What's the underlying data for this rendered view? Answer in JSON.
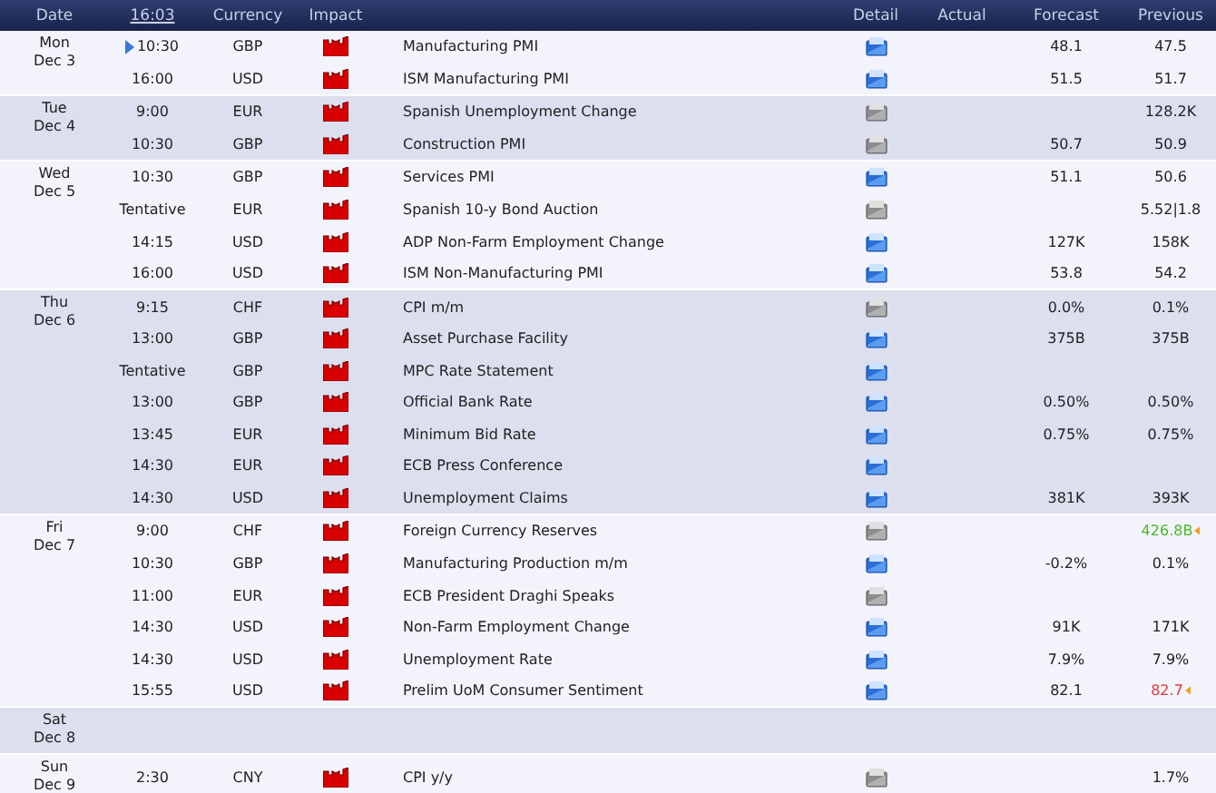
{
  "header": {
    "date": "Date",
    "clock": "16:03",
    "currency": "Currency",
    "impact": "Impact",
    "detail": "Detail",
    "actual": "Actual",
    "forecast": "Forecast",
    "previous": "Previous"
  },
  "days": [
    {
      "weekday": "Mon",
      "date": "Dec 3",
      "events": [
        {
          "time": "10:30",
          "next": true,
          "currency": "GBP",
          "high_impact": true,
          "event": "Manufacturing PMI",
          "detail": true,
          "forecast": "48.1",
          "previous": "47.5"
        },
        {
          "time": "16:00",
          "next": false,
          "currency": "USD",
          "high_impact": true,
          "event": "ISM Manufacturing PMI",
          "detail": true,
          "forecast": "51.5",
          "previous": "51.7"
        }
      ]
    },
    {
      "weekday": "Tue",
      "date": "Dec 4",
      "events": [
        {
          "time": "9:00",
          "next": false,
          "currency": "EUR",
          "high_impact": true,
          "event": "Spanish Unemployment Change",
          "detail": false,
          "previous": "128.2K"
        },
        {
          "time": "10:30",
          "next": false,
          "currency": "GBP",
          "high_impact": true,
          "event": "Construction PMI",
          "detail": false,
          "forecast": "50.7",
          "previous": "50.9"
        }
      ]
    },
    {
      "weekday": "Wed",
      "date": "Dec 5",
      "events": [
        {
          "time": "10:30",
          "next": false,
          "currency": "GBP",
          "high_impact": true,
          "event": "Services PMI",
          "detail": true,
          "forecast": "51.1",
          "previous": "50.6"
        },
        {
          "time": "Tentative",
          "next": false,
          "currency": "EUR",
          "high_impact": true,
          "event": "Spanish 10-y Bond Auction",
          "detail": false,
          "previous": "5.52|1.8"
        },
        {
          "time": "14:15",
          "next": false,
          "currency": "USD",
          "high_impact": true,
          "event": "ADP Non-Farm Employment Change",
          "detail": true,
          "forecast": "127K",
          "previous": "158K"
        },
        {
          "time": "16:00",
          "next": false,
          "currency": "USD",
          "high_impact": true,
          "event": "ISM Non-Manufacturing PMI",
          "detail": true,
          "forecast": "53.8",
          "previous": "54.2"
        }
      ]
    },
    {
      "weekday": "Thu",
      "date": "Dec 6",
      "events": [
        {
          "time": "9:15",
          "next": false,
          "currency": "CHF",
          "high_impact": true,
          "event": "CPI m/m",
          "detail": false,
          "forecast": "0.0%",
          "previous": "0.1%"
        },
        {
          "time": "13:00",
          "next": false,
          "currency": "GBP",
          "high_impact": true,
          "event": "Asset Purchase Facility",
          "detail": true,
          "forecast": "375B",
          "previous": "375B"
        },
        {
          "time": "Tentative",
          "next": false,
          "currency": "GBP",
          "high_impact": true,
          "event": "MPC Rate Statement",
          "detail": true
        },
        {
          "time": "13:00",
          "next": false,
          "currency": "GBP",
          "high_impact": true,
          "event": "Official Bank Rate",
          "detail": true,
          "forecast": "0.50%",
          "previous": "0.50%"
        },
        {
          "time": "13:45",
          "next": false,
          "currency": "EUR",
          "high_impact": true,
          "event": "Minimum Bid Rate",
          "detail": true,
          "forecast": "0.75%",
          "previous": "0.75%"
        },
        {
          "time": "14:30",
          "next": false,
          "currency": "EUR",
          "high_impact": true,
          "event": "ECB Press Conference",
          "detail": true
        },
        {
          "time": "14:30",
          "next": false,
          "currency": "USD",
          "high_impact": true,
          "event": "Unemployment Claims",
          "detail": true,
          "forecast": "381K",
          "previous": "393K"
        }
      ]
    },
    {
      "weekday": "Fri",
      "date": "Dec 7",
      "events": [
        {
          "time": "9:00",
          "next": false,
          "currency": "CHF",
          "high_impact": true,
          "event": "Foreign Currency Reserves",
          "detail": false,
          "previous": "426.8B",
          "revised": true,
          "color": "#4cb82c"
        },
        {
          "time": "10:30",
          "next": false,
          "currency": "GBP",
          "high_impact": true,
          "event": "Manufacturing Production m/m",
          "detail": true,
          "forecast": "-0.2%",
          "previous": "0.1%"
        },
        {
          "time": "11:00",
          "next": false,
          "currency": "EUR",
          "high_impact": true,
          "event": "ECB President Draghi Speaks",
          "detail": false
        },
        {
          "time": "14:30",
          "next": false,
          "currency": "USD",
          "high_impact": true,
          "event": "Non-Farm Employment Change",
          "detail": true,
          "forecast": "91K",
          "previous": "171K"
        },
        {
          "time": "14:30",
          "next": false,
          "currency": "USD",
          "high_impact": true,
          "event": "Unemployment Rate",
          "detail": true,
          "forecast": "7.9%",
          "previous": "7.9%"
        },
        {
          "time": "15:55",
          "next": false,
          "currency": "USD",
          "high_impact": true,
          "event": "Prelim UoM Consumer Sentiment",
          "detail": true,
          "forecast": "82.1",
          "previous": "82.7",
          "revised": true,
          "color": "#e03a3a"
        }
      ]
    },
    {
      "weekday": "Sat",
      "date": "Dec 8"
    },
    {
      "weekday": "Sun",
      "date": "Dec 9",
      "events": [
        {
          "time": "2:30",
          "next": false,
          "currency": "CNY",
          "high_impact": true,
          "event": "CPI y/y",
          "detail": false,
          "previous": "1.7%"
        }
      ]
    }
  ]
}
